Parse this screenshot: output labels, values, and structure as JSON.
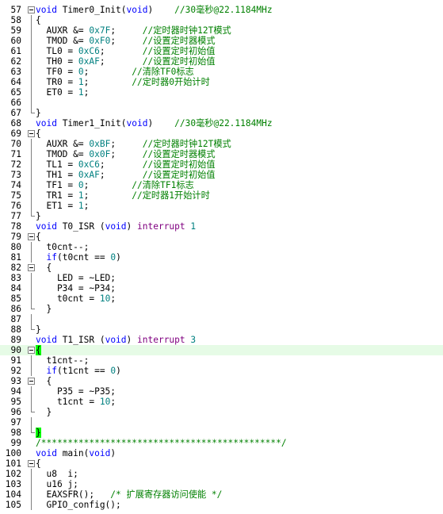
{
  "editor": {
    "lines": [
      {
        "n": "57",
        "fold": "start",
        "segs": [
          [
            "kw",
            "void"
          ],
          [
            "p",
            " Timer0_Init("
          ],
          [
            "kw",
            "void"
          ],
          [
            "p",
            ")    "
          ],
          [
            "cm",
            "//30毫秒@22.1184MHz"
          ]
        ]
      },
      {
        "n": "58",
        "fold": "line",
        "segs": [
          [
            "p",
            "{"
          ]
        ]
      },
      {
        "n": "59",
        "fold": "line",
        "segs": [
          [
            "p",
            "  AUXR &= "
          ],
          [
            "num",
            "0x7F"
          ],
          [
            "p",
            ";     "
          ],
          [
            "cm",
            "//定时器时钟12T模式"
          ]
        ]
      },
      {
        "n": "60",
        "fold": "line",
        "segs": [
          [
            "p",
            "  TMOD &= "
          ],
          [
            "num",
            "0xF0"
          ],
          [
            "p",
            ";     "
          ],
          [
            "cm",
            "//设置定时器模式"
          ]
        ]
      },
      {
        "n": "61",
        "fold": "line",
        "segs": [
          [
            "p",
            "  TL0 = "
          ],
          [
            "num",
            "0xC6"
          ],
          [
            "p",
            ";       "
          ],
          [
            "cm",
            "//设置定时初始值"
          ]
        ]
      },
      {
        "n": "62",
        "fold": "line",
        "segs": [
          [
            "p",
            "  TH0 = "
          ],
          [
            "num",
            "0xAF"
          ],
          [
            "p",
            ";       "
          ],
          [
            "cm",
            "//设置定时初始值"
          ]
        ]
      },
      {
        "n": "63",
        "fold": "line",
        "segs": [
          [
            "p",
            "  TF0 = "
          ],
          [
            "num",
            "0"
          ],
          [
            "p",
            ";        "
          ],
          [
            "cm",
            "//清除TF0标志"
          ]
        ]
      },
      {
        "n": "64",
        "fold": "line",
        "segs": [
          [
            "p",
            "  TR0 = "
          ],
          [
            "num",
            "1"
          ],
          [
            "p",
            ";        "
          ],
          [
            "cm",
            "//定时器0开始计时"
          ]
        ]
      },
      {
        "n": "65",
        "fold": "line",
        "segs": [
          [
            "p",
            "  ET0 = "
          ],
          [
            "num",
            "1"
          ],
          [
            "p",
            ";"
          ]
        ]
      },
      {
        "n": "66",
        "fold": "line",
        "segs": []
      },
      {
        "n": "67",
        "fold": "end",
        "segs": [
          [
            "p",
            "}"
          ]
        ]
      },
      {
        "n": "68",
        "fold": "none",
        "segs": [
          [
            "kw",
            "void"
          ],
          [
            "p",
            " Timer1_Init("
          ],
          [
            "kw",
            "void"
          ],
          [
            "p",
            ")    "
          ],
          [
            "cm",
            "//30毫秒@22.1184MHz"
          ]
        ]
      },
      {
        "n": "69",
        "fold": "start",
        "segs": [
          [
            "p",
            "{"
          ]
        ]
      },
      {
        "n": "70",
        "fold": "line",
        "segs": [
          [
            "p",
            "  AUXR &= "
          ],
          [
            "num",
            "0xBF"
          ],
          [
            "p",
            ";     "
          ],
          [
            "cm",
            "//定时器时钟12T模式"
          ]
        ]
      },
      {
        "n": "71",
        "fold": "line",
        "segs": [
          [
            "p",
            "  TMOD &= "
          ],
          [
            "num",
            "0x0F"
          ],
          [
            "p",
            ";     "
          ],
          [
            "cm",
            "//设置定时器模式"
          ]
        ]
      },
      {
        "n": "72",
        "fold": "line",
        "segs": [
          [
            "p",
            "  TL1 = "
          ],
          [
            "num",
            "0xC6"
          ],
          [
            "p",
            ";       "
          ],
          [
            "cm",
            "//设置定时初始值"
          ]
        ]
      },
      {
        "n": "73",
        "fold": "line",
        "segs": [
          [
            "p",
            "  TH1 = "
          ],
          [
            "num",
            "0xAF"
          ],
          [
            "p",
            ";       "
          ],
          [
            "cm",
            "//设置定时初始值"
          ]
        ]
      },
      {
        "n": "74",
        "fold": "line",
        "segs": [
          [
            "p",
            "  TF1 = "
          ],
          [
            "num",
            "0"
          ],
          [
            "p",
            ";        "
          ],
          [
            "cm",
            "//清除TF1标志"
          ]
        ]
      },
      {
        "n": "75",
        "fold": "line",
        "segs": [
          [
            "p",
            "  TR1 = "
          ],
          [
            "num",
            "1"
          ],
          [
            "p",
            ";        "
          ],
          [
            "cm",
            "//定时器1开始计时"
          ]
        ]
      },
      {
        "n": "76",
        "fold": "line",
        "segs": [
          [
            "p",
            "  ET1 = "
          ],
          [
            "num",
            "1"
          ],
          [
            "p",
            ";"
          ]
        ]
      },
      {
        "n": "77",
        "fold": "end",
        "segs": [
          [
            "p",
            "}"
          ]
        ]
      },
      {
        "n": "78",
        "fold": "none",
        "segs": [
          [
            "kw",
            "void"
          ],
          [
            "p",
            " T0_ISR ("
          ],
          [
            "kw",
            "void"
          ],
          [
            "p",
            ") "
          ],
          [
            "it",
            "interrupt"
          ],
          [
            "p",
            " "
          ],
          [
            "num",
            "1"
          ]
        ]
      },
      {
        "n": "79",
        "fold": "start",
        "segs": [
          [
            "p",
            "{"
          ]
        ]
      },
      {
        "n": "80",
        "fold": "line",
        "segs": [
          [
            "p",
            "  t0cnt--;"
          ]
        ]
      },
      {
        "n": "81",
        "fold": "line",
        "segs": [
          [
            "p",
            "  "
          ],
          [
            "kw",
            "if"
          ],
          [
            "p",
            "(t0cnt == "
          ],
          [
            "num",
            "0"
          ],
          [
            "p",
            ")"
          ]
        ]
      },
      {
        "n": "82",
        "fold": "start",
        "segs": [
          [
            "p",
            "  {"
          ]
        ]
      },
      {
        "n": "83",
        "fold": "line",
        "segs": [
          [
            "p",
            "    LED = ~LED;"
          ]
        ]
      },
      {
        "n": "84",
        "fold": "line",
        "segs": [
          [
            "p",
            "    P34 = ~P34;"
          ]
        ]
      },
      {
        "n": "85",
        "fold": "line",
        "segs": [
          [
            "p",
            "    t0cnt = "
          ],
          [
            "num",
            "10"
          ],
          [
            "p",
            ";"
          ]
        ]
      },
      {
        "n": "86",
        "fold": "end",
        "segs": [
          [
            "p",
            "  }"
          ]
        ]
      },
      {
        "n": "87",
        "fold": "line",
        "segs": []
      },
      {
        "n": "88",
        "fold": "end",
        "segs": [
          [
            "p",
            "}"
          ]
        ]
      },
      {
        "n": "89",
        "fold": "none",
        "segs": [
          [
            "kw",
            "void"
          ],
          [
            "p",
            " T1_ISR ("
          ],
          [
            "kw",
            "void"
          ],
          [
            "p",
            ") "
          ],
          [
            "it",
            "interrupt"
          ],
          [
            "p",
            " "
          ],
          [
            "num",
            "3"
          ]
        ]
      },
      {
        "n": "90",
        "fold": "start",
        "hl": true,
        "segs": [
          [
            "bh",
            "{"
          ]
        ]
      },
      {
        "n": "91",
        "fold": "line",
        "segs": [
          [
            "p",
            "  t1cnt--;"
          ]
        ]
      },
      {
        "n": "92",
        "fold": "line",
        "segs": [
          [
            "p",
            "  "
          ],
          [
            "kw",
            "if"
          ],
          [
            "p",
            "(t1cnt == "
          ],
          [
            "num",
            "0"
          ],
          [
            "p",
            ")"
          ]
        ]
      },
      {
        "n": "93",
        "fold": "start",
        "segs": [
          [
            "p",
            "  {"
          ]
        ]
      },
      {
        "n": "94",
        "fold": "line",
        "segs": [
          [
            "p",
            "    P35 = ~P35;"
          ]
        ]
      },
      {
        "n": "95",
        "fold": "line",
        "segs": [
          [
            "p",
            "    t1cnt = "
          ],
          [
            "num",
            "10"
          ],
          [
            "p",
            ";"
          ]
        ]
      },
      {
        "n": "96",
        "fold": "end",
        "segs": [
          [
            "p",
            "  }"
          ]
        ]
      },
      {
        "n": "97",
        "fold": "line",
        "segs": []
      },
      {
        "n": "98",
        "fold": "end",
        "segs": [
          [
            "bh",
            "}"
          ]
        ]
      },
      {
        "n": "99",
        "fold": "none",
        "segs": [
          [
            "cm",
            "/*********************************************/"
          ]
        ]
      },
      {
        "n": "100",
        "fold": "none",
        "segs": [
          [
            "kw",
            "void"
          ],
          [
            "p",
            " main("
          ],
          [
            "kw",
            "void"
          ],
          [
            "p",
            ")"
          ]
        ]
      },
      {
        "n": "101",
        "fold": "start",
        "segs": [
          [
            "p",
            "{"
          ]
        ]
      },
      {
        "n": "102",
        "fold": "line",
        "segs": [
          [
            "p",
            "  u8  i;"
          ]
        ]
      },
      {
        "n": "103",
        "fold": "line",
        "segs": [
          [
            "p",
            "  u16 j;"
          ]
        ]
      },
      {
        "n": "104",
        "fold": "line",
        "segs": [
          [
            "p",
            "  EAXSFR();   "
          ],
          [
            "cm",
            "/* 扩展寄存器访问使能 */"
          ]
        ]
      },
      {
        "n": "105",
        "fold": "line",
        "segs": [
          [
            "p",
            "  GPIO_config();"
          ]
        ]
      }
    ]
  }
}
